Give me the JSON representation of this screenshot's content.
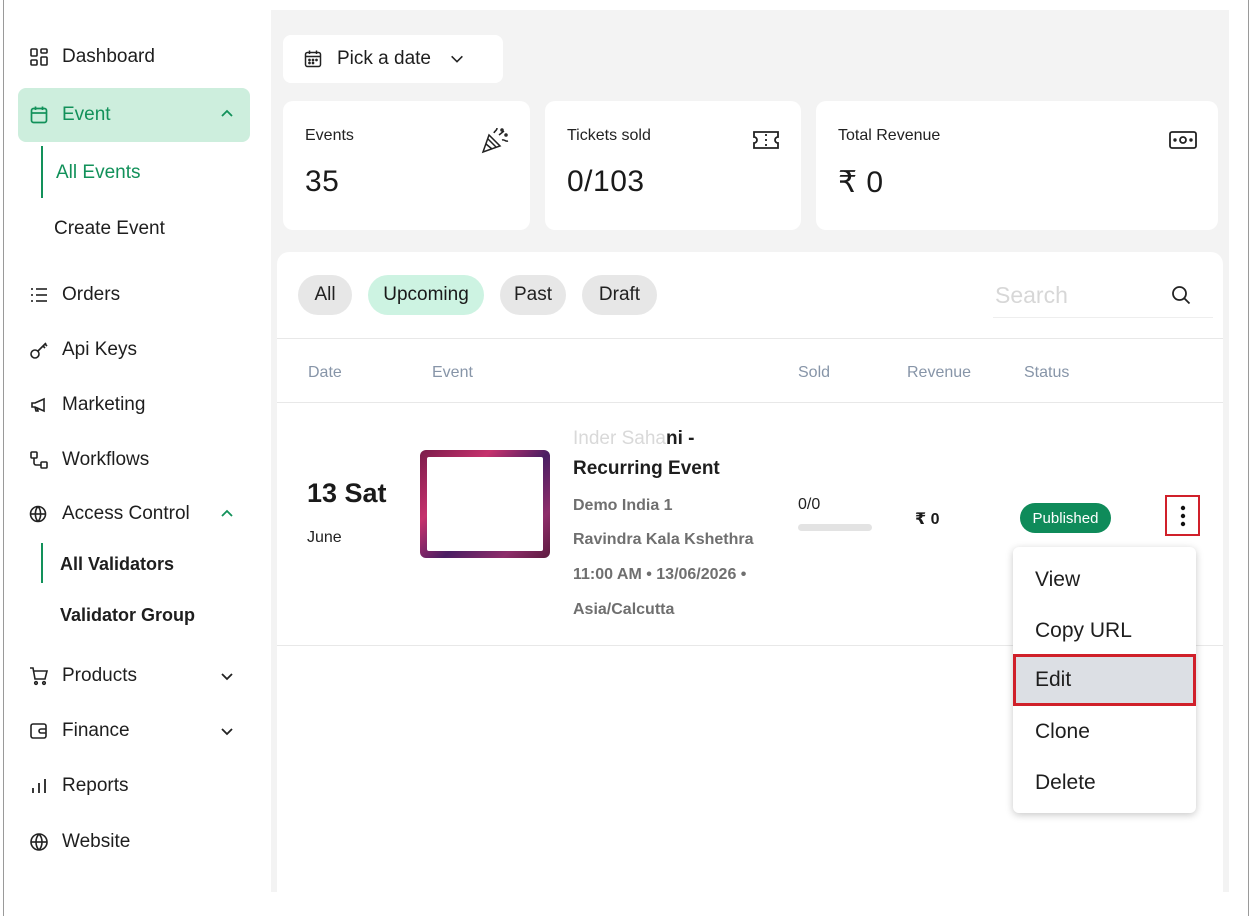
{
  "sidebar": {
    "items": [
      {
        "label": "Dashboard",
        "icon": "grid-icon"
      },
      {
        "label": "Event",
        "icon": "calendar-icon",
        "active": true,
        "expanded": true
      },
      {
        "label": "Orders",
        "icon": "list-icon"
      },
      {
        "label": "Api Keys",
        "icon": "key-icon"
      },
      {
        "label": "Marketing",
        "icon": "megaphone-icon"
      },
      {
        "label": "Workflows",
        "icon": "workflow-icon"
      },
      {
        "label": "Access Control",
        "icon": "globe-lock-icon",
        "expanded": true
      },
      {
        "label": "Products",
        "icon": "cart-icon"
      },
      {
        "label": "Finance",
        "icon": "wallet-icon"
      },
      {
        "label": "Reports",
        "icon": "bar-chart-icon"
      },
      {
        "label": "Website",
        "icon": "globe-icon"
      }
    ],
    "event_sub": [
      "All Events",
      "Create Event"
    ],
    "access_sub": [
      "All Validators",
      "Validator Group"
    ]
  },
  "date_picker": {
    "label": "Pick a date"
  },
  "stats": [
    {
      "title": "Events",
      "value": "35",
      "icon": "party-popper-icon"
    },
    {
      "title": "Tickets sold",
      "value": "0/103",
      "icon": "ticket-icon"
    },
    {
      "title": "Total Revenue",
      "value": "₹ 0",
      "icon": "banknote-icon"
    }
  ],
  "filters": [
    "All",
    "Upcoming",
    "Past",
    "Draft"
  ],
  "active_filter": "Upcoming",
  "search": {
    "placeholder": "Search"
  },
  "table": {
    "headers": [
      "Date",
      "Event",
      "Sold",
      "Revenue",
      "Status"
    ],
    "rows": [
      {
        "day": "13 Sat",
        "month": "June",
        "title_faded": "Inder Saha",
        "title_rest": "ni -",
        "title_line2": "Recurring Event",
        "venue": "Demo India 1",
        "place": "Ravindra Kala Kshethra",
        "datetime": "11:00 AM • 13/06/2026 •",
        "timezone": "Asia/Calcutta",
        "sold": "0/0",
        "sold_fraction": 0,
        "revenue": "₹ 0",
        "status": "Published"
      }
    ]
  },
  "row_menu": [
    "View",
    "Copy URL",
    "Edit",
    "Clone",
    "Delete"
  ],
  "highlighted_menu_item": "Edit",
  "colors": {
    "accent": "#12915a",
    "accent_bg": "#cdeedd",
    "highlight": "#d0202a",
    "published": "#0f8b5a"
  }
}
